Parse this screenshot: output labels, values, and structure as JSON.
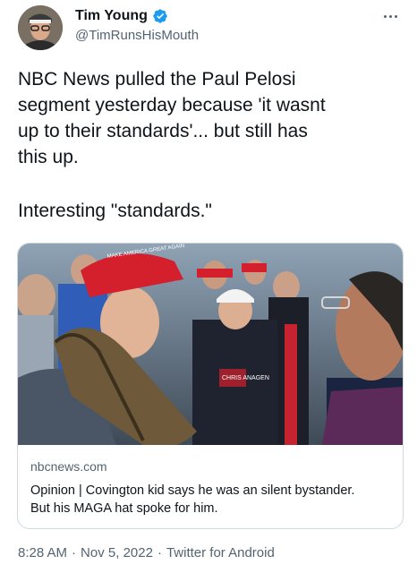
{
  "tweet": {
    "author": {
      "display_name": "Tim Young",
      "handle": "@TimRunsHisMouth",
      "verified": true,
      "avatar_icon": "profile-photo"
    },
    "more_icon": "ellipsis-icon",
    "text_paragraphs": [
      "NBC News pulled the Paul Pelosi\nsegment yesterday because 'it wasnt\nup to their standards'... but still has\nthis up.",
      "Interesting \"standards.\""
    ],
    "card": {
      "image_hat_text": "MAKE AMERICA GREAT AGAIN",
      "image_shirt_text": "CHRIS ANAGEN",
      "domain": "nbcnews.com",
      "title_line1": "Opinion | Covington kid says he was an silent bystander.",
      "title_line2": "But his MAGA hat spoke for him."
    },
    "footer": {
      "time": "8:28 AM",
      "separator": "·",
      "date": "Nov 5, 2022",
      "source": "Twitter for Android"
    }
  },
  "colors": {
    "verified_blue": "#1d9bf0",
    "secondary_text": "#536471",
    "border": "#cfd9de",
    "maga_red": "#d4202c"
  }
}
